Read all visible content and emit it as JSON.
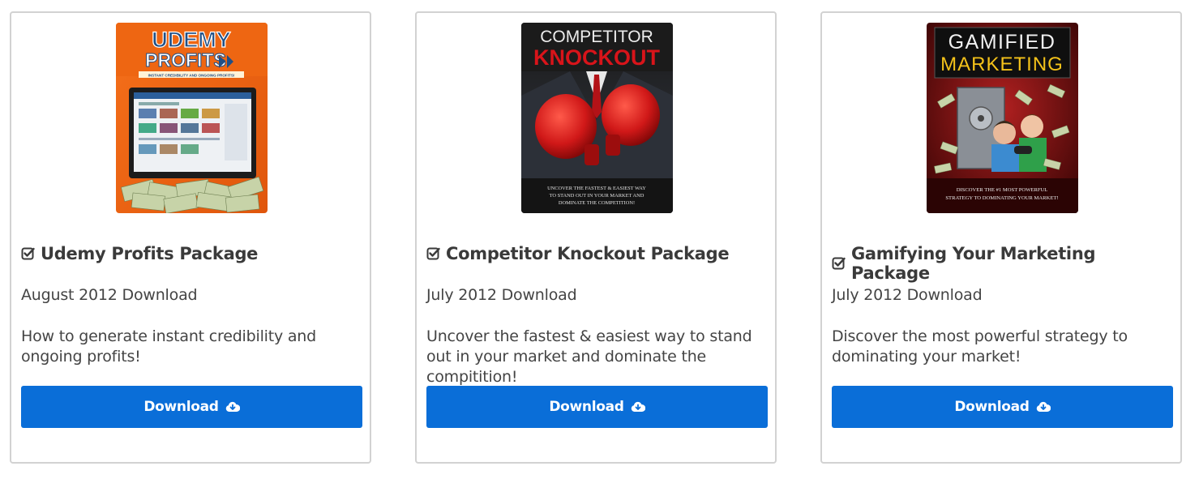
{
  "colors": {
    "button_bg": "#0a6ed8",
    "card_border": "#d2d2d2",
    "text": "#444444"
  },
  "cards": [
    {
      "cover": {
        "title_line1": "UDEMY",
        "title_line2": "PROFITS",
        "tagline": "INSTANT CREDIBILITY AND ONGOING PROFITS!"
      },
      "title": "Udemy Profits Package",
      "date": "August 2012 Download",
      "description": "How to generate instant credibility and ongoing profits!",
      "button_label": "Download",
      "icons": {
        "title": "check-square-icon",
        "button": "cloud-download-icon"
      }
    },
    {
      "cover": {
        "title_line1": "COMPETITOR",
        "title_line2": "KNOCKOUT",
        "tagline_line1": "UNCOVER THE FASTEST & EASIEST WAY",
        "tagline_line2": "TO STAND OUT IN YOUR MARKET AND",
        "tagline_line3": "DOMINATE THE COMPETITION!"
      },
      "title": "Competitor Knockout Package",
      "date": "July 2012 Download",
      "description": "Uncover the fastest & easiest way to stand out in your market and dominate the compitition!",
      "button_label": "Download",
      "icons": {
        "title": "check-square-icon",
        "button": "cloud-download-icon"
      }
    },
    {
      "cover": {
        "title_line1": "GAMIFIED",
        "title_line2": "MARKETING",
        "tagline_line1": "DISCOVER THE #1 MOST POWERFUL",
        "tagline_line2": "STRATEGY TO DOMINATING YOUR MARKET!"
      },
      "title": "Gamifying Your Marketing Package",
      "date": "July 2012 Download",
      "description": "Discover the most powerful strategy to dominating your market!",
      "button_label": "Download",
      "icons": {
        "title": "check-square-icon",
        "button": "cloud-download-icon"
      }
    }
  ]
}
